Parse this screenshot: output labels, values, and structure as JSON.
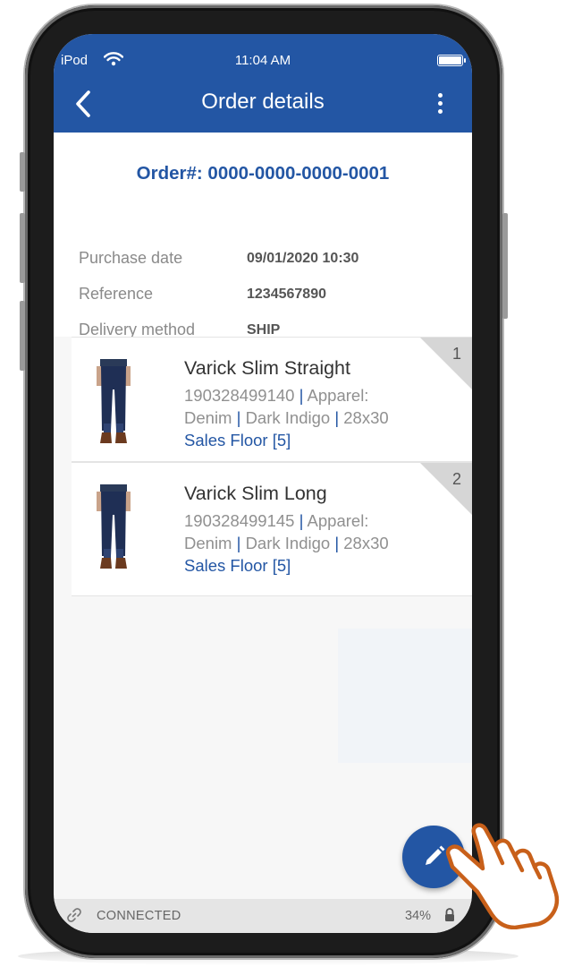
{
  "status_bar": {
    "carrier": "iPod",
    "time": "11:04 AM"
  },
  "header": {
    "title": "Order details"
  },
  "order": {
    "number": "Order#: 0000-0000-0000-0001",
    "fields": [
      {
        "label": "Purchase date",
        "value": "09/01/2020 10:30"
      },
      {
        "label": "Reference",
        "value": "1234567890"
      },
      {
        "label": "Delivery method",
        "value": "SHIP"
      }
    ]
  },
  "items": [
    {
      "index": "1",
      "name": "Varick Slim Straight",
      "sku": "190328499140",
      "category": "Apparel:",
      "fabric": "Denim",
      "color": "Dark Indigo",
      "size": "28x30",
      "location": "Sales Floor [5]"
    },
    {
      "index": "2",
      "name": "Varick Slim Long",
      "sku": "190328499145",
      "category": "Apparel:",
      "fabric": "Denim",
      "color": "Dark Indigo",
      "size": "28x30",
      "location": "Sales Floor [5]"
    }
  ],
  "connection": {
    "status": "CONNECTED",
    "battery": "34%"
  },
  "icons": {
    "back": "chevron-left-icon",
    "more": "more-vertical-icon",
    "edit": "pencil-icon",
    "link": "link-icon",
    "lock": "lock-icon",
    "hand": "tap-hand-icon"
  },
  "colors": {
    "primary": "#2356a4",
    "connection_bar": "#e5e5e5",
    "accent_hand": "#c8601a"
  }
}
